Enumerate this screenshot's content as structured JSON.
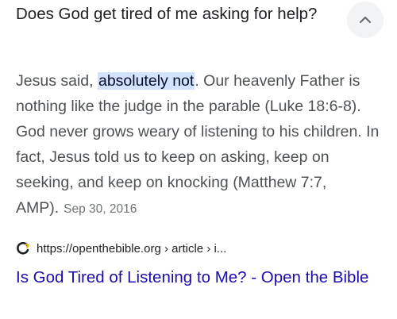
{
  "question": {
    "text": "Does God get tired of me asking for help?"
  },
  "collapse_button": {
    "icon": "chevron-up-icon"
  },
  "answer": {
    "before_highlight": "Jesus said, ",
    "highlight": "absolutely not",
    "after_highlight": ". Our heavenly Father is nothing like the judge in the parable (Luke 18:6-8). God never grows weary of listening to his children. In fact, Jesus told us to keep on asking, keep on seeking, and keep on knocking (Matthew 7:7, AMP).",
    "date": "Sep 30, 2016"
  },
  "source": {
    "favicon": "openthebible-logo-icon",
    "url": "https://openthebible.org › article › i..."
  },
  "result": {
    "title": "Is God Tired of Listening to Me? - Open the Bible"
  },
  "colors": {
    "link": "#1a0dab",
    "highlight_bg": "#d3e3fd",
    "body_text": "#4d5156",
    "heading_text": "#202124",
    "date_text": "#70757a"
  }
}
